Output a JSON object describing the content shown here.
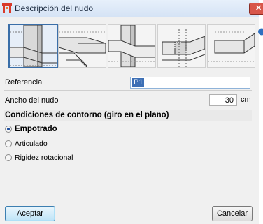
{
  "window": {
    "title": "Descripción del nudo"
  },
  "icons": {
    "app": "app-icon",
    "close": "close-icon",
    "help": "help-icon"
  },
  "thumbnails": [
    {
      "name": "node-type-1",
      "selected": true
    },
    {
      "name": "node-type-2",
      "selected": false
    },
    {
      "name": "node-type-3",
      "selected": false
    },
    {
      "name": "node-type-4",
      "selected": false
    },
    {
      "name": "node-type-5",
      "selected": false
    }
  ],
  "form": {
    "referencia_label": "Referencia",
    "referencia_value": "P1",
    "ancho_label": "Ancho del nudo",
    "ancho_value": "30",
    "ancho_unit": "cm"
  },
  "conditions": {
    "title": "Condiciones de contorno (giro en el plano)",
    "options": [
      {
        "label": "Empotrado",
        "checked": true
      },
      {
        "label": "Articulado",
        "checked": false
      },
      {
        "label": "Rigidez rotacional",
        "checked": false
      }
    ]
  },
  "buttons": {
    "accept": "Aceptar",
    "cancel": "Cancelar"
  },
  "colors": {
    "accent": "#3d6fb5",
    "close": "#d8564a"
  }
}
